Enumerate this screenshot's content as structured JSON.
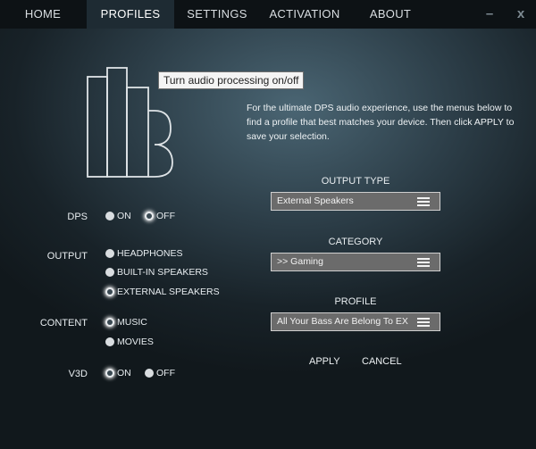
{
  "nav": {
    "tabs": [
      {
        "label": "HOME"
      },
      {
        "label": "PROFILES"
      },
      {
        "label": "SETTINGS"
      },
      {
        "label": "ACTIVATION"
      },
      {
        "label": "ABOUT"
      }
    ],
    "active_tab": "PROFILES",
    "minimize_label": "–",
    "close_label": "x"
  },
  "tooltip": "Turn audio processing on/off",
  "intro_text": "For the ultimate DPS audio experience, use the menus below to find a profile that best matches your device. Then click APPLY to save your selection.",
  "options": {
    "dps": {
      "label": "DPS",
      "choices": [
        {
          "label": "ON",
          "selected": false
        },
        {
          "label": "OFF",
          "selected": true
        }
      ]
    },
    "output": {
      "label": "OUTPUT",
      "choices": [
        {
          "label": "HEADPHONES",
          "selected": false
        },
        {
          "label": "BUILT-IN SPEAKERS",
          "selected": false
        },
        {
          "label": "EXTERNAL SPEAKERS",
          "selected": true
        }
      ]
    },
    "content": {
      "label": "CONTENT",
      "choices": [
        {
          "label": "MUSIC",
          "selected": true
        },
        {
          "label": "MOVIES",
          "selected": false
        }
      ]
    },
    "v3d": {
      "label": "V3D",
      "choices": [
        {
          "label": "ON",
          "selected": true
        },
        {
          "label": "OFF",
          "selected": false
        }
      ]
    }
  },
  "selectors": {
    "output_type": {
      "title": "OUTPUT TYPE",
      "value": "External Speakers"
    },
    "category": {
      "title": "CATEGORY",
      "value": ">> Gaming"
    },
    "profile": {
      "title": "PROFILE",
      "value": "All Your Bass Are Belong To EX"
    }
  },
  "actions": {
    "apply": "APPLY",
    "cancel": "CANCEL"
  },
  "colors": {
    "nav_bg": "#0d1215",
    "active_tab_bg": "#1e2b33",
    "dropdown_bg": "#6b6b6b"
  }
}
